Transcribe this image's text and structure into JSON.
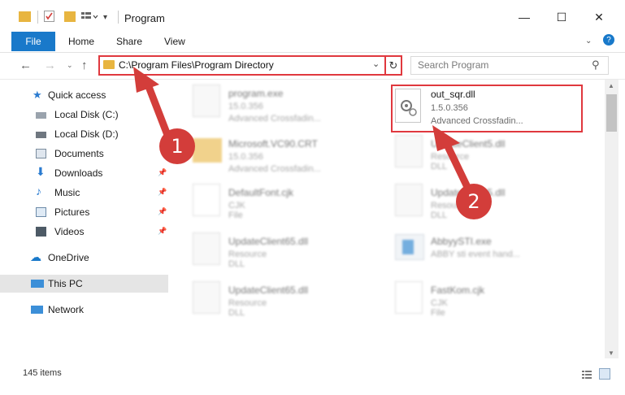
{
  "window": {
    "title": "Program",
    "minimize": "—",
    "maximize": "☐",
    "close": "✕"
  },
  "ribbon": {
    "file": "File",
    "home": "Home",
    "share": "Share",
    "view": "View"
  },
  "address": {
    "path": "C:\\Program Files\\Program Directory"
  },
  "search": {
    "placeholder": "Search Program"
  },
  "nav": {
    "quick_access": "Quick access",
    "items": [
      {
        "label": "Local Disk (C:)"
      },
      {
        "label": "Local Disk (D:)"
      },
      {
        "label": "Documents"
      },
      {
        "label": "Downloads"
      },
      {
        "label": "Music"
      },
      {
        "label": "Pictures"
      },
      {
        "label": "Videos"
      }
    ],
    "onedrive": "OneDrive",
    "this_pc": "This PC",
    "network": "Network"
  },
  "files": [
    {
      "name": "program.exe",
      "sub1": "15.0.356",
      "sub2": "Advanced Crossfadin..."
    },
    {
      "name": "Microsoft.VC90.CRT",
      "sub1": "15.0.356",
      "sub2": "Advanced Crossfadin..."
    },
    {
      "name": "DefaultFont.cjk",
      "sub1": "CJK File",
      "sub2": ""
    },
    {
      "name": "UpdateClient65.dll",
      "sub1": "Resource DLL",
      "sub2": ""
    },
    {
      "name": "UpdateClient65.dll",
      "sub1": "Resource DLL",
      "sub2": ""
    },
    {
      "name": "out_sqr.dll",
      "sub1": "1.5.0.356",
      "sub2": "Advanced Crossfadin..."
    },
    {
      "name": "UpdateClient5.dll",
      "sub1": "Resource DLL",
      "sub2": ""
    },
    {
      "name": "UpdateClient5.dll",
      "sub1": "Resource DLL",
      "sub2": ""
    },
    {
      "name": "AbbyySTI.exe",
      "sub1": "ABBY sti event hand...",
      "sub2": ""
    },
    {
      "name": "FastKom.cjk",
      "sub1": "CJK File",
      "sub2": ""
    }
  ],
  "status": {
    "count": "145 items"
  },
  "annotations": {
    "step1": "1",
    "step2": "2"
  },
  "colors": {
    "accent": "#1979ca",
    "highlight": "#e0383e",
    "arrow": "#d33d3a"
  }
}
